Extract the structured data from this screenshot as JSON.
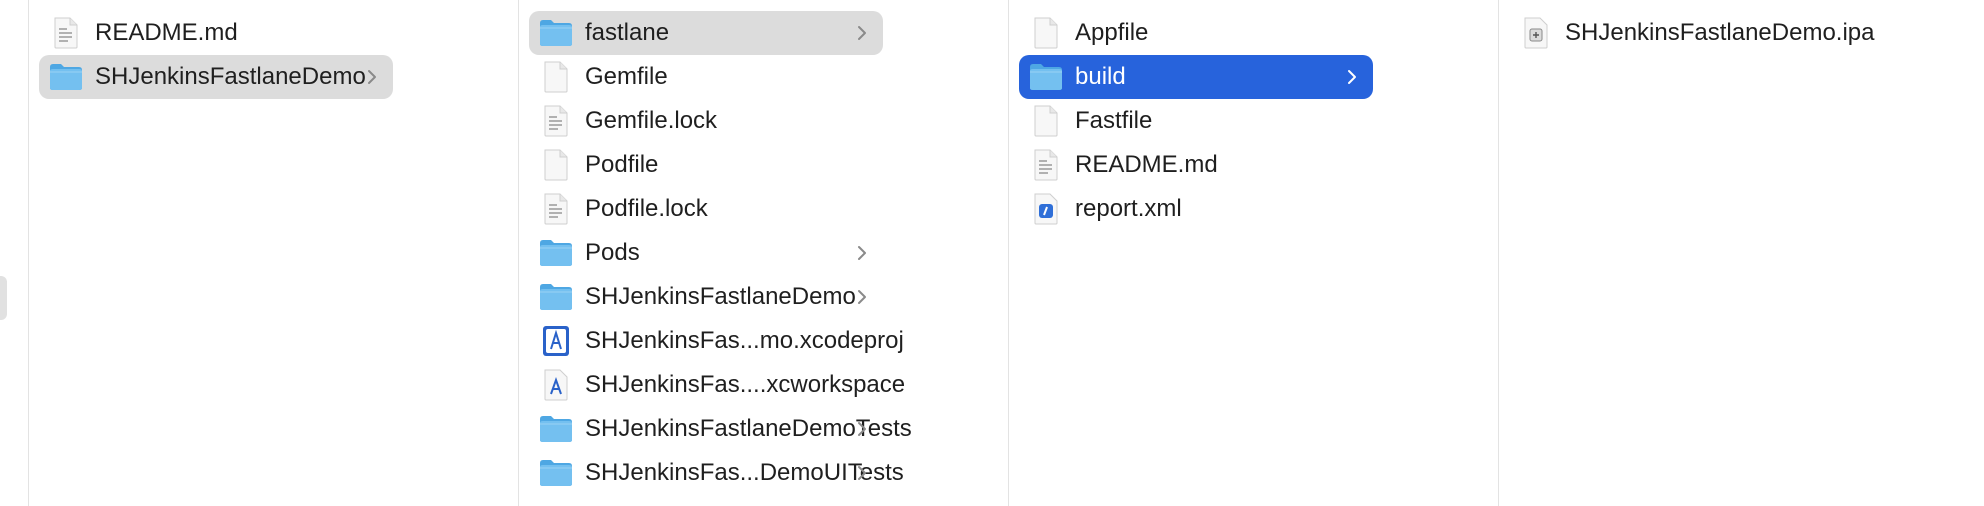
{
  "colors": {
    "selection_gray": "#dcdcdc",
    "selection_blue": "#2763dc",
    "folder": "#6bb8ea"
  },
  "columns": [
    {
      "items": [
        {
          "label": "README.md",
          "icon": "text-document-icon",
          "chevron": false,
          "selected": "none"
        },
        {
          "label": "SHJenkinsFastlaneDemo",
          "icon": "folder-icon",
          "chevron": true,
          "selected": "gray"
        }
      ]
    },
    {
      "items": [
        {
          "label": "fastlane",
          "icon": "folder-icon",
          "chevron": true,
          "selected": "gray"
        },
        {
          "label": "Gemfile",
          "icon": "blank-document-icon",
          "chevron": false,
          "selected": "none"
        },
        {
          "label": "Gemfile.lock",
          "icon": "text-document-icon",
          "chevron": false,
          "selected": "none"
        },
        {
          "label": "Podfile",
          "icon": "blank-document-icon",
          "chevron": false,
          "selected": "none"
        },
        {
          "label": "Podfile.lock",
          "icon": "text-document-icon",
          "chevron": false,
          "selected": "none"
        },
        {
          "label": "Pods",
          "icon": "folder-icon",
          "chevron": true,
          "selected": "none"
        },
        {
          "label": "SHJenkinsFastlaneDemo",
          "icon": "folder-icon",
          "chevron": true,
          "selected": "none"
        },
        {
          "label": "SHJenkinsFas...mo.xcodeproj",
          "icon": "xcodeproj-icon",
          "chevron": false,
          "selected": "none"
        },
        {
          "label": "SHJenkinsFas....xcworkspace",
          "icon": "xcworkspace-icon",
          "chevron": false,
          "selected": "none"
        },
        {
          "label": "SHJenkinsFastlaneDemoTests",
          "icon": "folder-icon",
          "chevron": true,
          "selected": "none"
        },
        {
          "label": "SHJenkinsFas...DemoUITests",
          "icon": "folder-icon",
          "chevron": true,
          "selected": "none"
        }
      ]
    },
    {
      "items": [
        {
          "label": "Appfile",
          "icon": "blank-document-icon",
          "chevron": false,
          "selected": "none"
        },
        {
          "label": "build",
          "icon": "folder-icon",
          "chevron": true,
          "selected": "blue"
        },
        {
          "label": "Fastfile",
          "icon": "blank-document-icon",
          "chevron": false,
          "selected": "none"
        },
        {
          "label": "README.md",
          "icon": "text-document-icon",
          "chevron": false,
          "selected": "none"
        },
        {
          "label": "report.xml",
          "icon": "xml-document-icon",
          "chevron": false,
          "selected": "none"
        }
      ]
    },
    {
      "items": [
        {
          "label": "SHJenkinsFastlaneDemo.ipa",
          "icon": "ipa-archive-icon",
          "chevron": false,
          "selected": "none"
        }
      ]
    }
  ]
}
